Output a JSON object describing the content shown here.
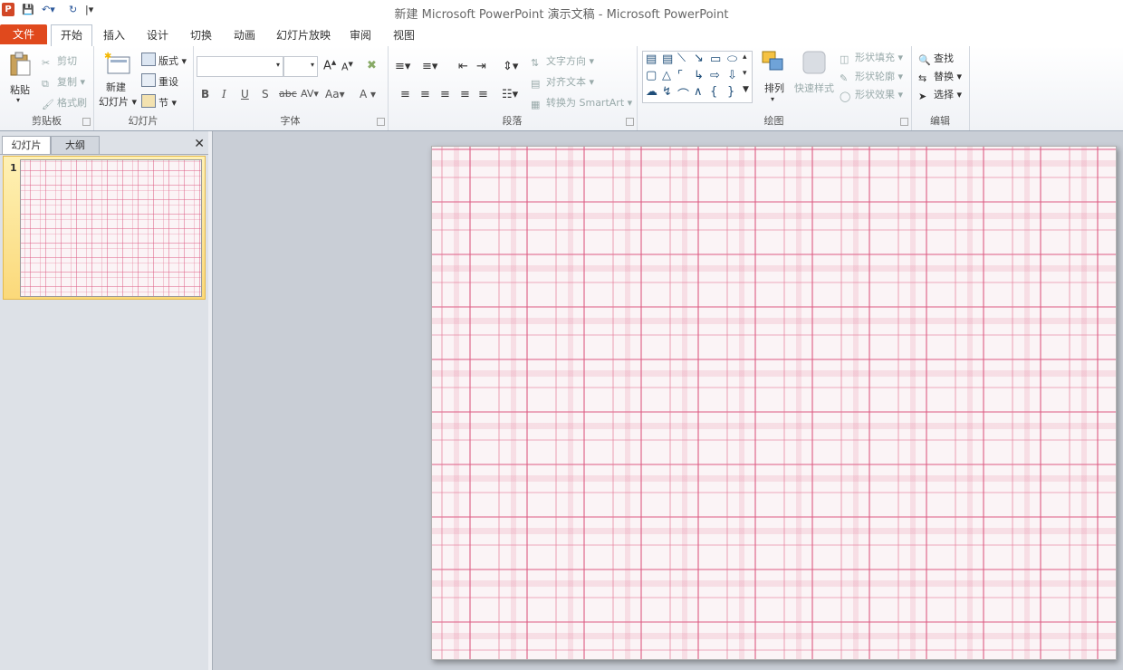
{
  "app_title": "新建 Microsoft PowerPoint 演示文稿 - Microsoft PowerPoint",
  "logo_letter": "P",
  "tabs": [
    "文件",
    "开始",
    "插入",
    "设计",
    "切换",
    "动画",
    "幻灯片放映",
    "审阅",
    "视图"
  ],
  "clipboard": {
    "paste": "粘贴",
    "cut": "剪切",
    "copy": "复制",
    "format_painter": "格式刷",
    "label": "剪贴板"
  },
  "slides_group": {
    "new_slide_line1": "新建",
    "new_slide_line2": "幻灯片",
    "layout": "版式",
    "reset": "重设",
    "section": "节",
    "label": "幻灯片"
  },
  "font_group": {
    "label": "字体",
    "bold": "B",
    "italic": "I",
    "underline": "U",
    "shadow": "S",
    "strike": "abc",
    "spacing": "AV",
    "case": "Aa",
    "color": "A",
    "grow": "A",
    "shrink": "A"
  },
  "paragraph_group": {
    "text_direction": "文字方向",
    "align_text": "对齐文本",
    "smartart": "转换为 SmartArt",
    "label": "段落"
  },
  "drawing_group": {
    "arrange": "排列",
    "quick_styles": "快速样式",
    "shape_fill": "形状填充",
    "shape_outline": "形状轮廓",
    "shape_effects": "形状效果",
    "label": "绘图"
  },
  "editing_group": {
    "find": "查找",
    "replace": "替换",
    "select": "选择",
    "label": "编辑"
  },
  "left_pane": {
    "tab_slides": "幻灯片",
    "tab_outline": "大纲",
    "slide_number": "1"
  },
  "colors": {
    "file_tab": "#e0491d",
    "thumb_highlight": "#fbd97a"
  }
}
